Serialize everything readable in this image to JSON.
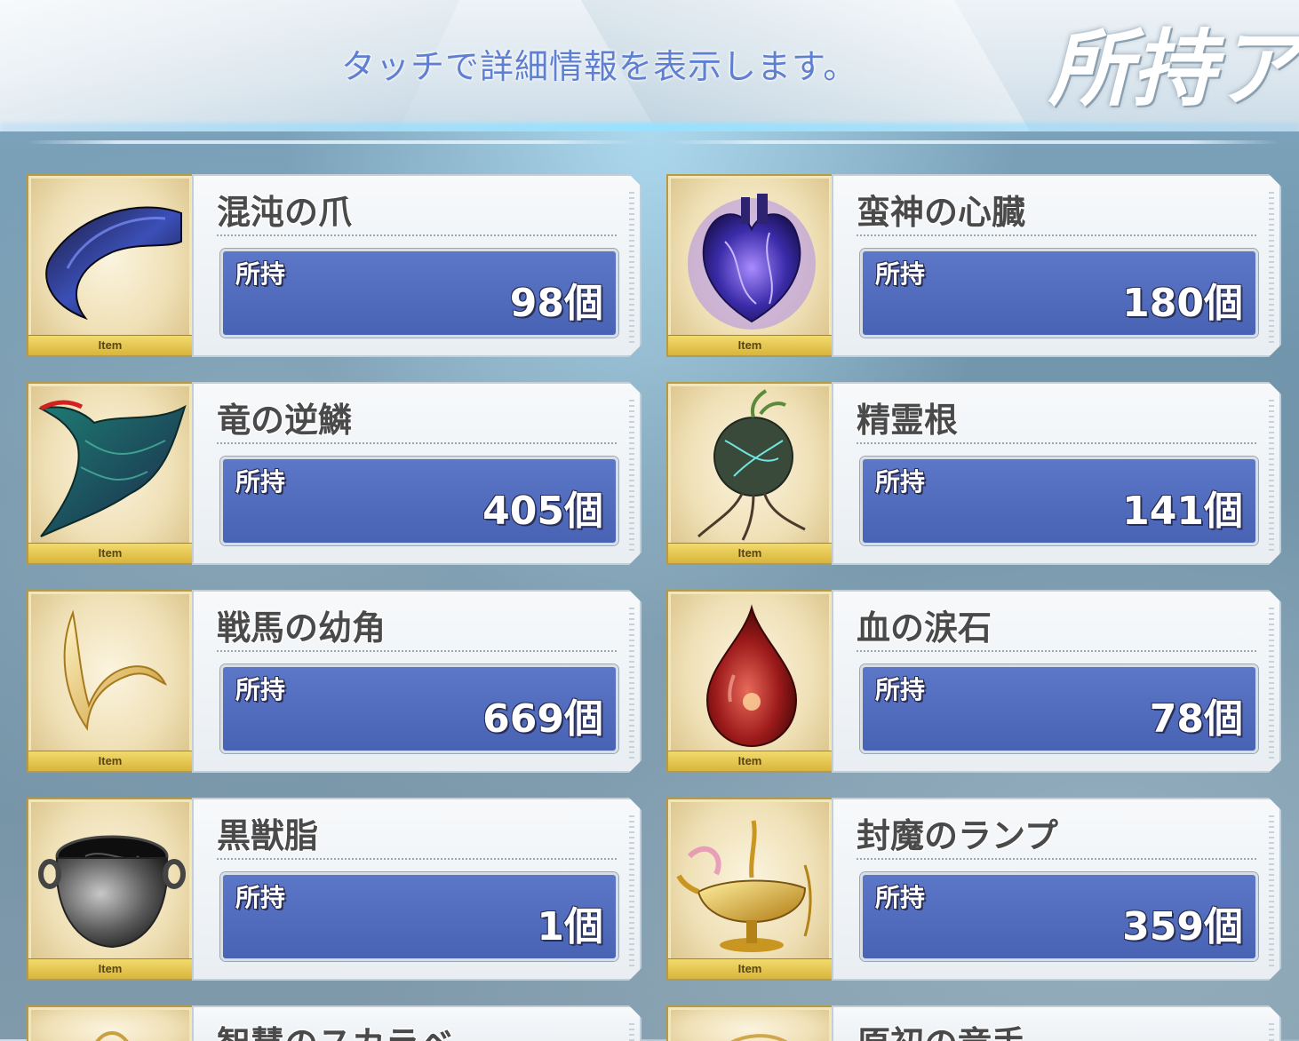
{
  "header": {
    "hint": "タッチで詳細情報を表示します。",
    "title": "所持ア"
  },
  "qty_label": "所持",
  "thumb_tag": "Item",
  "items": [
    {
      "name": "混沌の爪",
      "quantity": "98個",
      "icon": "claw-icon"
    },
    {
      "name": "蛮神の心臓",
      "quantity": "180個",
      "icon": "heart-icon"
    },
    {
      "name": "竜の逆鱗",
      "quantity": "405個",
      "icon": "dragon-scale-icon"
    },
    {
      "name": "精霊根",
      "quantity": "141個",
      "icon": "spirit-root-icon"
    },
    {
      "name": "戦馬の幼角",
      "quantity": "669個",
      "icon": "horn-icon"
    },
    {
      "name": "血の涙石",
      "quantity": "78個",
      "icon": "blood-tear-stone-icon"
    },
    {
      "name": "黒獣脂",
      "quantity": "1個",
      "icon": "black-tallow-pot-icon"
    },
    {
      "name": "封魔のランプ",
      "quantity": "359個",
      "icon": "magic-lamp-icon"
    },
    {
      "name": "智慧のスカラベ",
      "icon": "scarab-icon"
    },
    {
      "name": "原初の竜手",
      "icon": "dragon-hand-icon"
    }
  ],
  "colors": {
    "quantity_box": "#4f69b9",
    "item_tag": "#e3c24e",
    "hint_text": "#5f7fd0"
  }
}
